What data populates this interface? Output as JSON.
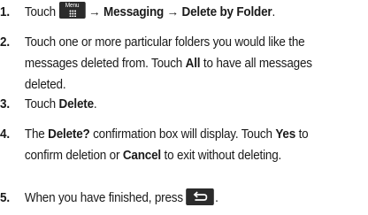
{
  "steps": [
    {
      "number": "1.",
      "pre": "Touch",
      "menu_key_caption": "Menu",
      "arrow1": "→",
      "item1": "Messaging",
      "arrow2": "→",
      "item2": "Delete by Folder",
      "end": "."
    },
    {
      "number": "2.",
      "line1": "Touch one or more particular folders you would like the",
      "line2_pre": "messages deleted from. Touch ",
      "line2_bold": "All",
      "line2_post": " to have all messages",
      "line3": "deleted."
    },
    {
      "number": "3.",
      "pre": "Touch ",
      "bold": "Delete",
      "end": "."
    },
    {
      "number": "4.",
      "line1_pre": "The ",
      "line1_bold1": "Delete?",
      "line1_mid": " confirmation box will display. Touch ",
      "line1_bold2": "Yes",
      "line1_post": " to",
      "line2_pre": "confirm deletion or ",
      "line2_bold": "Cancel",
      "line2_post": " to exit without deleting."
    },
    {
      "number": "5.",
      "pre": "When you have finished, press",
      "end": "."
    }
  ],
  "icons": {
    "menu_key": "menu-key-icon",
    "back_key": "back-key-icon"
  }
}
